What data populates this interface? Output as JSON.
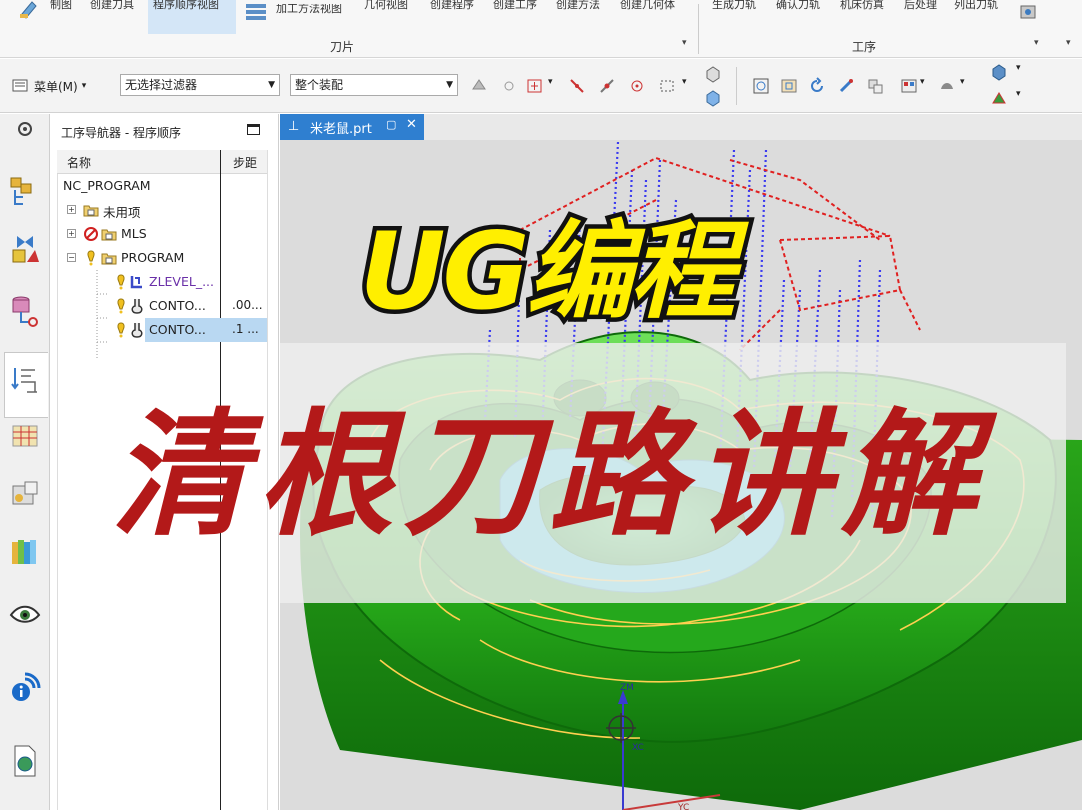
{
  "ribbon": {
    "items": [
      {
        "label": "制图"
      },
      {
        "label": "创建刀具"
      },
      {
        "label": "程序顺序视图"
      },
      {
        "label": "加工方法视图"
      },
      {
        "label": "几何视图"
      },
      {
        "label": "创建程序"
      },
      {
        "label": "创建工序"
      },
      {
        "label": "创建方法"
      },
      {
        "label": "创建几何体"
      },
      {
        "label": "生成刀轨"
      },
      {
        "label": "确认刀轨"
      },
      {
        "label": "机床仿真"
      },
      {
        "label": "后处理"
      },
      {
        "label": "列出刀轨"
      }
    ],
    "groups": {
      "toolpath": "刀片",
      "operation": "工序"
    }
  },
  "toolbar": {
    "menu_label": "菜单(M)",
    "filter_value": "无选择过滤器",
    "assembly_value": "整个装配"
  },
  "navigator": {
    "title": "工序导航器 - 程序顺序",
    "col_name": "名称",
    "col_step": "步距",
    "rows": [
      {
        "label": "NC_PROGRAM",
        "step": ""
      },
      {
        "label": "未用项",
        "step": ""
      },
      {
        "label": "MLS",
        "step": ""
      },
      {
        "label": "PROGRAM",
        "step": ""
      },
      {
        "label": "ZLEVEL_...",
        "step": ""
      },
      {
        "label": "CONTO...",
        "step": ".00..."
      },
      {
        "label": "CONTO...",
        "step": ".1 ..."
      }
    ]
  },
  "viewport": {
    "tab_label": "米老鼠.prt",
    "axis_zm": "ZM",
    "axis_xc": "XC",
    "axis_yc": "YC"
  },
  "overlay": {
    "title_line1": "UG编程",
    "title_line2": "清根刀路讲解"
  },
  "colors": {
    "part_green": "#2fbd1e",
    "toolpath_blue": "#3a3af0",
    "toolpath_red": "#e02020",
    "cutting_yellow": "#ffd050",
    "title_yellow": "#ffef00",
    "title_red": "#b31919",
    "tab_blue": "#2f7fd0"
  }
}
